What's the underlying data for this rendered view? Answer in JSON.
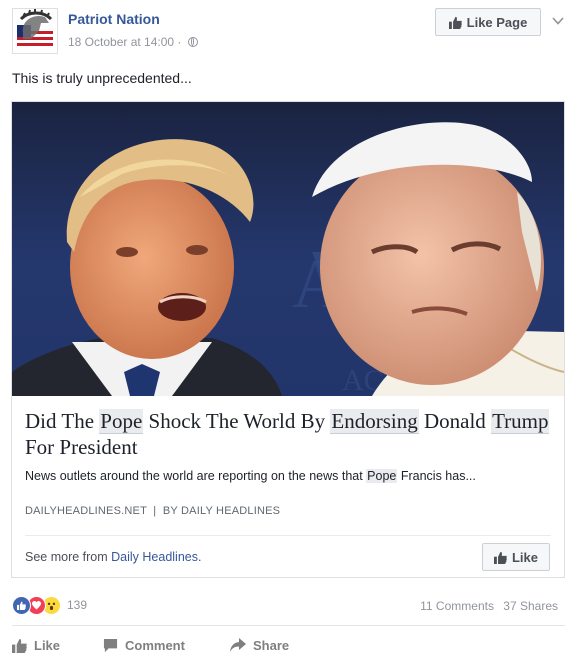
{
  "post": {
    "page_name": "Patriot Nation",
    "timestamp": "18 October at 14:00",
    "like_page_label": "Like Page",
    "caption": "This is truly unprecedented..."
  },
  "link": {
    "title_parts": [
      "Did The ",
      "Pope",
      " Shock The World By ",
      "Endorsing",
      " Donald ",
      "Trump",
      " For President"
    ],
    "desc_parts": [
      "News outlets around the world are reporting on the news that ",
      "Pope",
      " Francis has..."
    ],
    "domain": "DAILYHEADLINES.NET",
    "byline": "BY DAILY HEADLINES",
    "see_more_prefix": "See more from ",
    "see_more_link": "Daily Headlines",
    "see_more_suffix": ".",
    "like_label": "Like"
  },
  "engagement": {
    "reaction_icons": [
      "like-reaction-icon",
      "love-reaction-icon",
      "wow-reaction-icon"
    ],
    "reaction_count": "139",
    "comments": "11 Comments",
    "shares": "37 Shares"
  },
  "actions": {
    "like": "Like",
    "comment": "Comment",
    "share": "Share"
  },
  "colors": {
    "link_blue": "#365899",
    "like_blue": "#4267b2",
    "love_red": "#f33e58",
    "wow_yellow": "#fcd93f"
  }
}
